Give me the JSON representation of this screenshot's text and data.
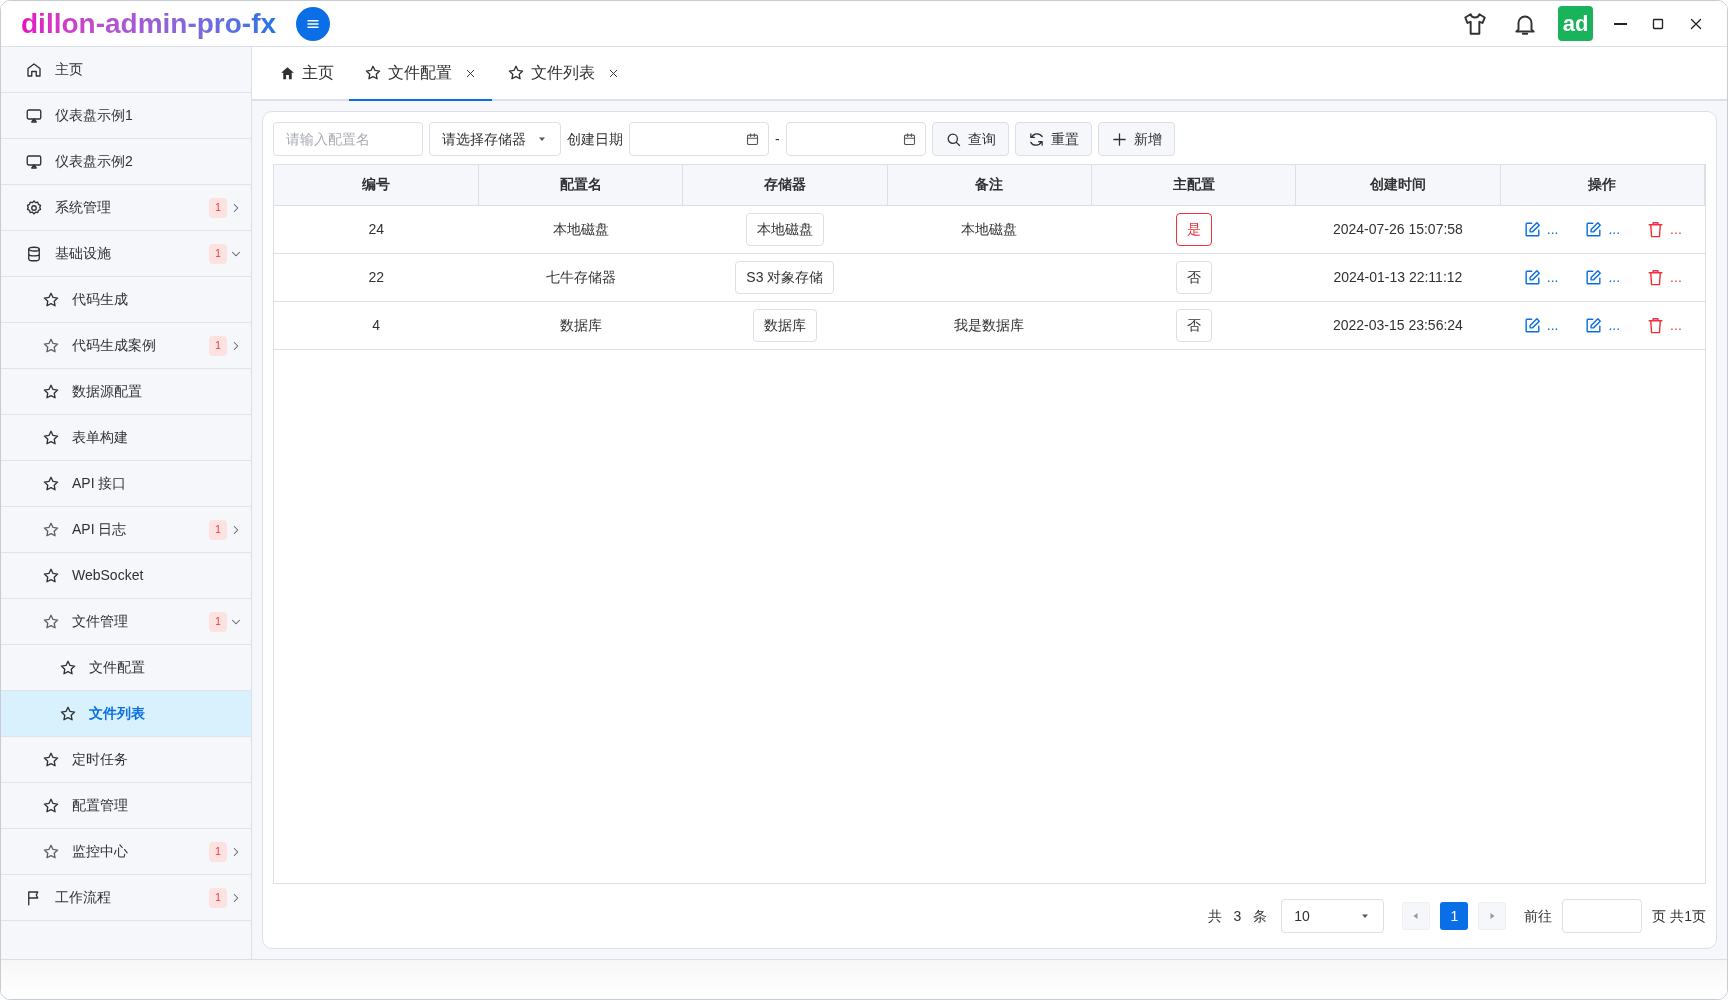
{
  "app": {
    "title": "dillon-admin-pro-fx",
    "avatar": "ad"
  },
  "sidebar": {
    "items": [
      {
        "label": "主页",
        "selected": false
      },
      {
        "label": "仪表盘示例1",
        "selected": false
      },
      {
        "label": "仪表盘示例2",
        "selected": false
      },
      {
        "label": "系统管理",
        "selected": false,
        "badge": "1",
        "expanded": false
      },
      {
        "label": "基础设施",
        "selected": false,
        "badge": "1",
        "expanded": true,
        "children": [
          {
            "label": "代码生成",
            "selected": false
          },
          {
            "label": "代码生成案例",
            "selected": false,
            "badge": "1",
            "expanded": false
          },
          {
            "label": "数据源配置",
            "selected": false
          },
          {
            "label": "表单构建",
            "selected": false
          },
          {
            "label": "API 接口",
            "selected": false
          },
          {
            "label": "API 日志",
            "selected": false,
            "badge": "1",
            "expanded": false
          },
          {
            "label": "WebSocket",
            "selected": false
          },
          {
            "label": "文件管理",
            "selected": false,
            "badge": "1",
            "expanded": true,
            "children": [
              {
                "label": "文件配置",
                "selected": false
              },
              {
                "label": "文件列表",
                "selected": true
              }
            ]
          },
          {
            "label": "定时任务",
            "selected": false
          },
          {
            "label": "配置管理",
            "selected": false
          },
          {
            "label": "监控中心",
            "selected": false,
            "badge": "1",
            "expanded": false
          }
        ]
      },
      {
        "label": "工作流程",
        "selected": false,
        "badge": "1",
        "expanded": false
      }
    ]
  },
  "tabs": [
    {
      "label": "主页",
      "selected": false,
      "kind": "home"
    },
    {
      "label": "文件配置",
      "selected": true,
      "kind": "closable"
    },
    {
      "label": "文件列表",
      "selected": false,
      "kind": "closable"
    }
  ],
  "toolbar": {
    "name_field": {
      "placeholder": "请输入配置名"
    },
    "storage_select": {
      "placeholder": "请选择存储器"
    },
    "date_label": "创建日期",
    "date_separator": "-",
    "buttons": [
      {
        "label": "查询",
        "kind": "search"
      },
      {
        "label": "重置",
        "kind": "reset"
      },
      {
        "label": "新增",
        "kind": "add"
      }
    ]
  },
  "table": {
    "columns": [
      "编号",
      "配置名",
      "存储器",
      "备注",
      "主配置",
      "创建时间",
      "操作"
    ],
    "rows": [
      {
        "id": "24",
        "name": "本地磁盘",
        "storage": "本地磁盘",
        "remark": "本地磁盘",
        "primary": {
          "label": "是",
          "on": true
        },
        "created": "2024-07-26 15:07:58",
        "actions": [
          {
            "kind": "edit",
            "label": "..."
          },
          {
            "kind": "edit",
            "label": "..."
          },
          {
            "kind": "delete",
            "label": "..."
          }
        ]
      },
      {
        "id": "22",
        "name": "七牛存储器",
        "storage": "S3 对象存储",
        "remark": "",
        "primary": {
          "label": "否",
          "on": false
        },
        "created": "2024-01-13 22:11:12",
        "actions": [
          {
            "kind": "edit",
            "label": "..."
          },
          {
            "kind": "edit",
            "label": "..."
          },
          {
            "kind": "delete",
            "label": "..."
          }
        ]
      },
      {
        "id": "4",
        "name": "数据库",
        "storage": "数据库",
        "remark": "我是数据库",
        "primary": {
          "label": "否",
          "on": false
        },
        "created": "2022-03-15 23:56:24",
        "actions": [
          {
            "kind": "edit",
            "label": "..."
          },
          {
            "kind": "edit",
            "label": "..."
          },
          {
            "kind": "delete",
            "label": "..."
          }
        ]
      }
    ]
  },
  "pagination": {
    "total": "共 3 条",
    "page_size": "10",
    "pages": [
      {
        "label": "1",
        "selected": true
      }
    ],
    "goto_label": "前往",
    "page_total": "页 共1页"
  }
}
